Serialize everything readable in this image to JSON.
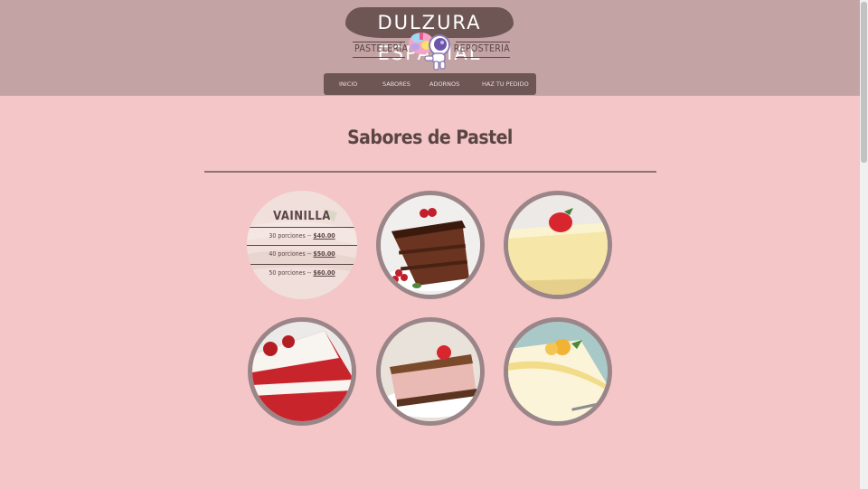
{
  "brand": {
    "name": "DULZURA ESPACIAL",
    "left_tag": "PASTELERÍA",
    "right_tag": "REPOSTERIA"
  },
  "nav": {
    "items": [
      {
        "label": "Inicio"
      },
      {
        "label": "Sabores"
      },
      {
        "label": "Adornos"
      },
      {
        "label": "Haz tu pedido"
      }
    ]
  },
  "page": {
    "title": "Sabores de Pastel"
  },
  "flavors": {
    "vainilla": {
      "name": "VAINILLA",
      "options": [
        {
          "portions": "30 porciones --",
          "price": "$40.00"
        },
        {
          "portions": "40 porciones --",
          "price": "$50.00"
        },
        {
          "portions": "50 porciones --",
          "price": "$60.00"
        }
      ]
    },
    "cakes": [
      {
        "icon": "chocolate-cake-icon"
      },
      {
        "icon": "cheesecake-strawberry-icon"
      },
      {
        "icon": "red-velvet-cake-icon"
      },
      {
        "icon": "mousse-cake-icon"
      },
      {
        "icon": "tres-leches-cake-icon"
      }
    ]
  },
  "colors": {
    "header_bg": "#c4a3a5",
    "page_bg": "#f4c6c7",
    "nav_bg": "#6e5654",
    "text": "#5a4544"
  }
}
